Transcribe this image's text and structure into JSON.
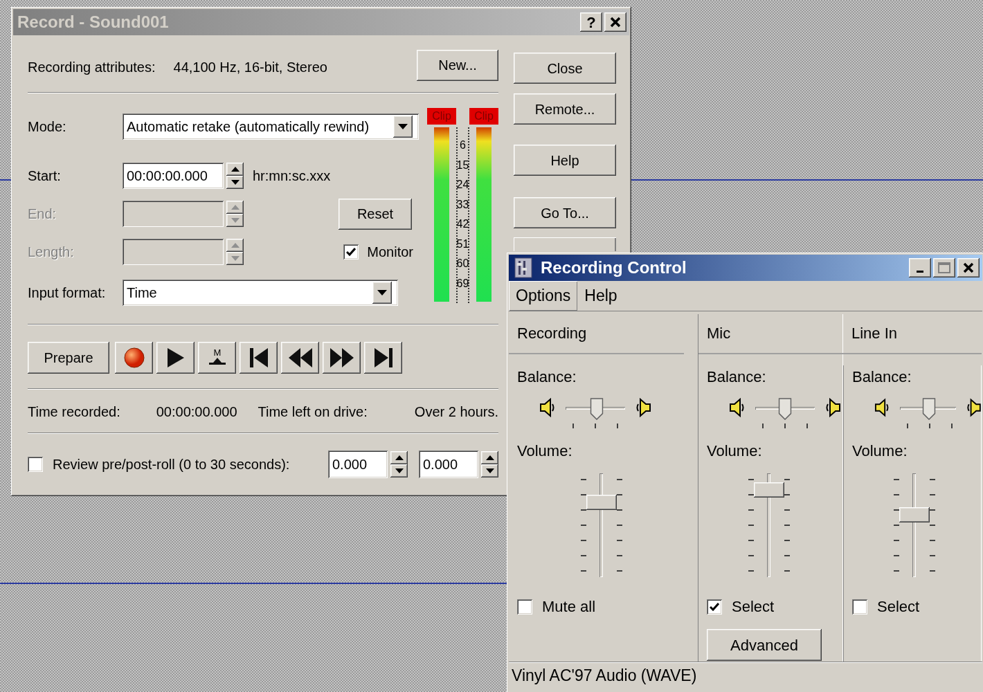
{
  "record_window": {
    "title": "Record - Sound001",
    "help_button": "?",
    "attributes_label": "Recording attributes:",
    "attributes_value": "44,100 Hz, 16-bit, Stereo",
    "new_button": "New...",
    "fields": [
      {
        "kind": "dropdown",
        "label": "Mode:",
        "value": "Automatic retake (automatically rewind)",
        "disabled": false
      },
      {
        "kind": "spin",
        "label": "Start:",
        "value": "00:00:00.000",
        "hint": "hr:mn:sc.xxx",
        "disabled": false
      },
      {
        "kind": "spin",
        "label": "End:",
        "disabled": true
      },
      {
        "kind": "spin",
        "label": "Length:",
        "disabled": true
      },
      {
        "kind": "dropdown",
        "label": "Input format:",
        "value": "Time",
        "disabled": false
      }
    ],
    "reset_button": "Reset",
    "monitor": {
      "label": "Monitor",
      "checked": true
    },
    "meters": [
      {
        "clip": "Clip",
        "level": 1
      },
      {
        "clip": "Clip",
        "level": 1
      }
    ],
    "meter_scale": [
      "6",
      "15",
      "24",
      "33",
      "42",
      "51",
      "60",
      "69"
    ],
    "prepare_button": "Prepare",
    "transport": [
      {
        "kind": "record"
      },
      {
        "kind": "play"
      },
      {
        "kind": "mark",
        "glyph": "M"
      },
      {
        "kind": "start"
      },
      {
        "kind": "rewind"
      },
      {
        "kind": "forward"
      },
      {
        "kind": "end"
      }
    ],
    "time_recorded_label": "Time recorded:",
    "time_recorded": "00:00:00.000",
    "time_left_label": "Time left on drive:",
    "time_left": "Over 2 hours.",
    "review": {
      "label": "Review pre/post-roll (0 to 30 seconds):",
      "checked": false,
      "values": [
        "0.000",
        "0.000"
      ]
    },
    "side_buttons": [
      "Close",
      "Remote...",
      "Help",
      "Go To..."
    ],
    "covered_button": true
  },
  "mixer_window": {
    "title": "Recording Control",
    "menu": [
      {
        "label": "Options",
        "selected": true
      },
      {
        "label": "Help",
        "selected": false
      }
    ],
    "columns": [
      {
        "name": "Recording",
        "balance_label": "Balance:",
        "balance": {
          "level": 0.52
        },
        "volume_label": "Volume:",
        "volume": {
          "level": 0.72
        },
        "check": {
          "label": "Mute all",
          "checked": false
        }
      },
      {
        "name": "Mic",
        "balance_label": "Balance:",
        "balance": {
          "level": 0.5
        },
        "volume_label": "Volume:",
        "volume": {
          "level": 0.84
        },
        "check": {
          "label": "Select",
          "checked": true
        },
        "advanced_button": "Advanced"
      },
      {
        "name": "Line In",
        "balance_label": "Balance:",
        "balance": {
          "level": 0.52
        },
        "volume_label": "Volume:",
        "volume": {
          "level": 0.6
        },
        "check": {
          "label": "Select",
          "checked": false
        }
      }
    ],
    "status": "Vinyl AC'97 Audio (WAVE)"
  }
}
